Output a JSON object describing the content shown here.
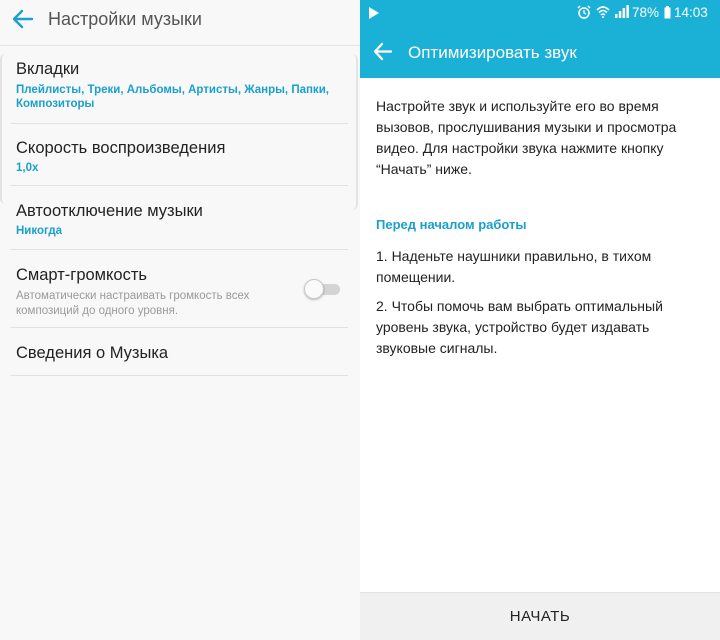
{
  "colors": {
    "accent": "#1bb1d6",
    "link_text": "#1aa0cc"
  },
  "music_settings": {
    "title": "Настройки музыки",
    "back_icon": "arrow-left-icon",
    "items": [
      {
        "title": "Вкладки",
        "summary": "Плейлисты, Треки, Альбомы, Артисты, Жанры, Папки, Композиторы"
      },
      {
        "title": "Скорость воспроизведения",
        "summary": "1,0x"
      },
      {
        "title": "Автоотключение музыки",
        "summary": "Никогда"
      },
      {
        "title": "Смарт-громкость",
        "summary": "Автоматически настраивать громкость всех композиций до одного уровня.",
        "toggle": false
      },
      {
        "title": "Сведения о Музыка"
      }
    ]
  },
  "status_bar": {
    "battery": "78%",
    "time": "14:03",
    "icons": [
      "play-icon",
      "alarm-icon",
      "wifi-icon",
      "signal-icon",
      "battery-icon"
    ]
  },
  "optimize_sound": {
    "title": "Оптимизировать звук",
    "back_icon": "arrow-left-icon",
    "intro": "Настройте звук и используйте его во время вызовов, прослушивания музыки и просмотра видео. Для настройки звука нажмите кнопку “Начать” ниже.",
    "before_heading": "Перед началом работы",
    "step1": "1. Наденьте наушники правильно, в тихом помещении.",
    "step2": "2. Чтобы помочь вам выбрать оптимальный уровень звука, устройство будет издавать звуковые сигналы.",
    "start_button": "НАЧАТЬ"
  }
}
